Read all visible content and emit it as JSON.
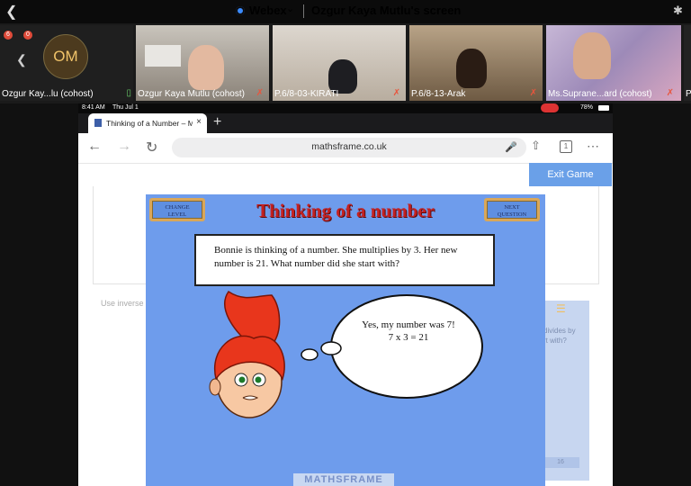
{
  "webex": {
    "app_label": "Webex",
    "screen_title": "Ozgur Kaya Mutlu's screen"
  },
  "participants": [
    {
      "name": "Ozgur Kay...lu (cohost)",
      "initials": "OM"
    },
    {
      "name": "Ozgur Kaya Mutlu (cohost)"
    },
    {
      "name": "P.6/8-03-KIRATI"
    },
    {
      "name": "P.6/8-13-Arak"
    },
    {
      "name": "Ms.Suprane...ard (cohost)"
    },
    {
      "name": "P"
    }
  ],
  "badges": {
    "left": "6",
    "right": "0"
  },
  "ipad_status": {
    "time": "8:41 AM",
    "date": "Thu Jul 1",
    "battery": "78%"
  },
  "browser": {
    "tab_title": "Thinking of a Number – M",
    "url": "mathsframe.co.uk"
  },
  "page": {
    "exit_label": "Exit Game",
    "inverse_hint": "Use inverse o",
    "side_text": "divides by\nrt with?",
    "side_num": "16"
  },
  "game": {
    "title": "Thinking of a number",
    "change_level": "CHANGE\nLEVEL",
    "next_question": "NEXT\nQUESTION",
    "question": "Bonnie is thinking of a number. She multiplies by 3. Her new number is 21. What number did she start with?",
    "answer_line1": "Yes, my number was 7!",
    "answer_line2": "7 x 3 = 21",
    "brand": "MATHSFRAME"
  }
}
